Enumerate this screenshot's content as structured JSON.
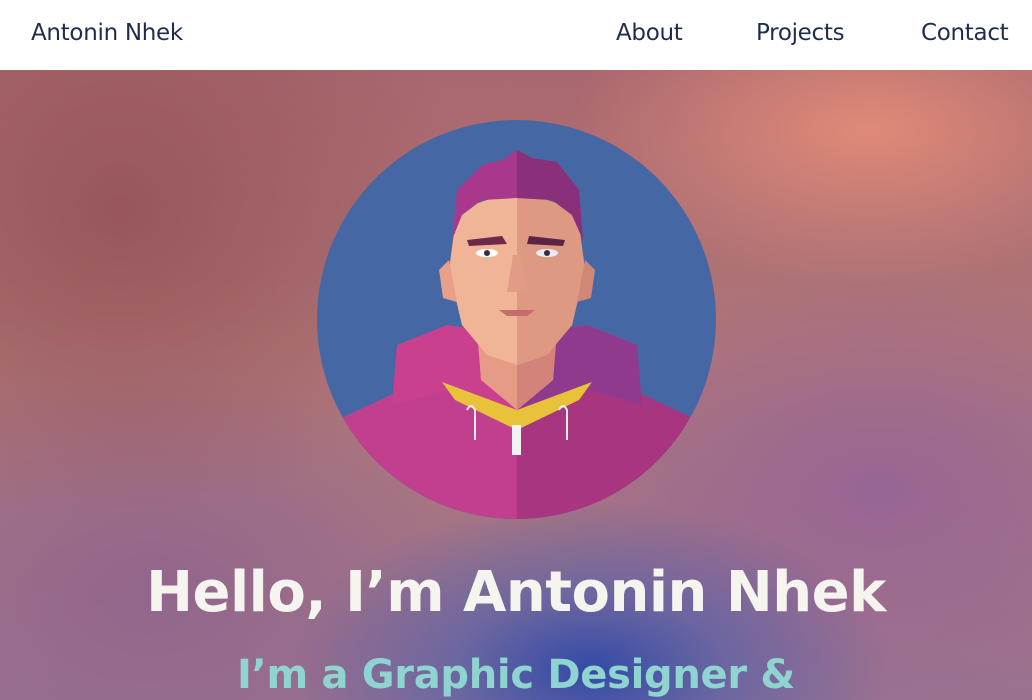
{
  "header": {
    "brand": "Antonin Nhek",
    "nav": [
      {
        "label": "About"
      },
      {
        "label": "Projects"
      },
      {
        "label": "Contact"
      }
    ]
  },
  "hero": {
    "greeting": "Hello, I’m Antonin Nhek",
    "subtitle": "I’m a Graphic Designer &"
  },
  "colors": {
    "nav_text": "#1f2d4d",
    "avatar_bg": "#4567a4",
    "greeting": "#f6f4ee",
    "subtitle": "#8fd4d0"
  }
}
